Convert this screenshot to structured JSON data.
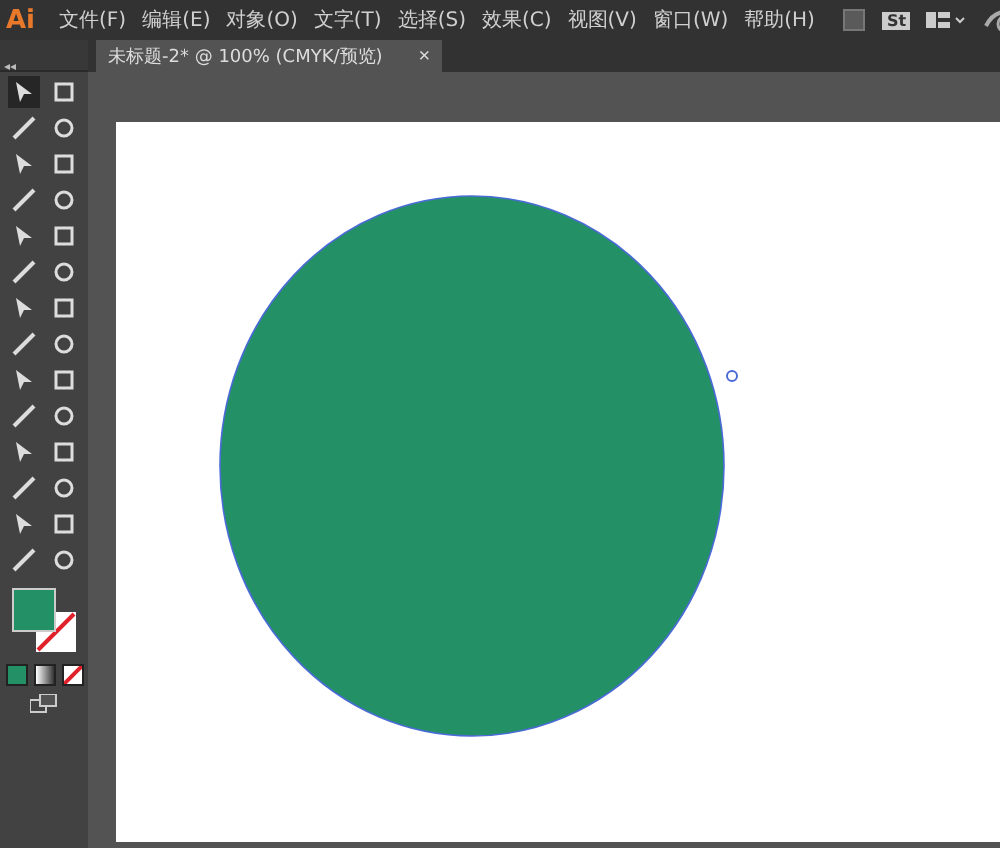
{
  "app": {
    "logo": "Ai"
  },
  "menu": [
    {
      "label": "文件(F)"
    },
    {
      "label": "编辑(E)"
    },
    {
      "label": "对象(O)"
    },
    {
      "label": "文字(T)"
    },
    {
      "label": "选择(S)"
    },
    {
      "label": "效果(C)"
    },
    {
      "label": "视图(V)"
    },
    {
      "label": "窗口(W)"
    },
    {
      "label": "帮助(H)"
    }
  ],
  "menu_icons": {
    "stock": "St"
  },
  "toolbar": {
    "collapse": "◂◂"
  },
  "document_tab": {
    "title": "未标题-2* @ 100% (CMYK/预览)",
    "close": "×",
    "selected": true
  },
  "fill": {
    "color": "#239066"
  },
  "artwork": {
    "kind": "ellipse",
    "selected": true
  }
}
